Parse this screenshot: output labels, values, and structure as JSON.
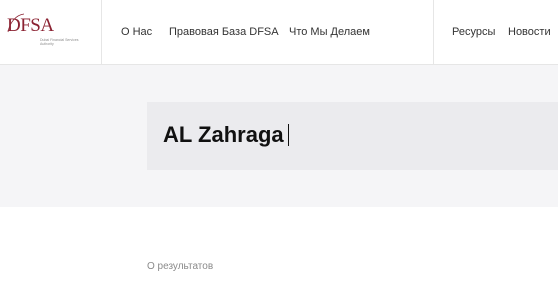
{
  "logo": {
    "text": "DFSA",
    "tagline": "Dubai Financial Services Authority"
  },
  "nav": {
    "items": [
      {
        "label": "О Нас"
      },
      {
        "label": "Правовая База DFSA"
      },
      {
        "label": "Что Мы Делаем"
      },
      {
        "label": "Ресурсы"
      },
      {
        "label": "Новости"
      }
    ]
  },
  "search": {
    "value": "AL Zahraga"
  },
  "results": {
    "info": "О результатов"
  },
  "colors": {
    "brand": "#8b2232",
    "band_background": "#f5f5f7",
    "search_background": "#ebebee"
  }
}
